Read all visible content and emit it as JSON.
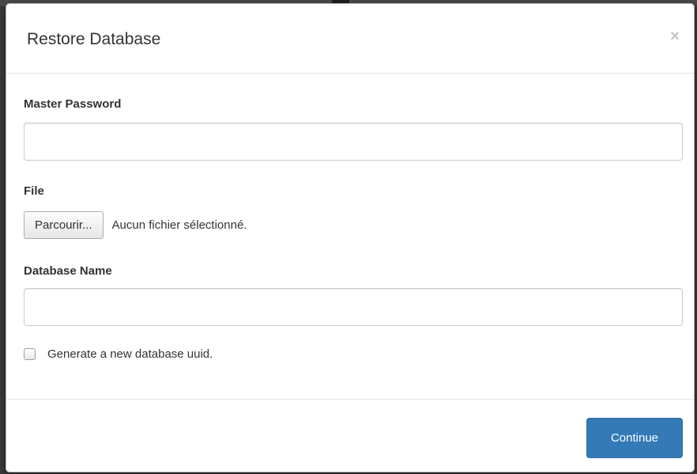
{
  "modal": {
    "title": "Restore Database",
    "close_label": "×"
  },
  "form": {
    "master_password": {
      "label": "Master Password",
      "value": "",
      "placeholder": ""
    },
    "file": {
      "label": "File",
      "browse_label": "Parcourir...",
      "status": "Aucun fichier sélectionné."
    },
    "database_name": {
      "label": "Database Name",
      "value": "",
      "placeholder": ""
    },
    "generate_uuid": {
      "label": "Generate a new database uuid.",
      "checked": false
    }
  },
  "footer": {
    "continue_label": "Continue"
  },
  "colors": {
    "primary": "#337ab7",
    "text": "#333333",
    "border": "#cccccc"
  }
}
